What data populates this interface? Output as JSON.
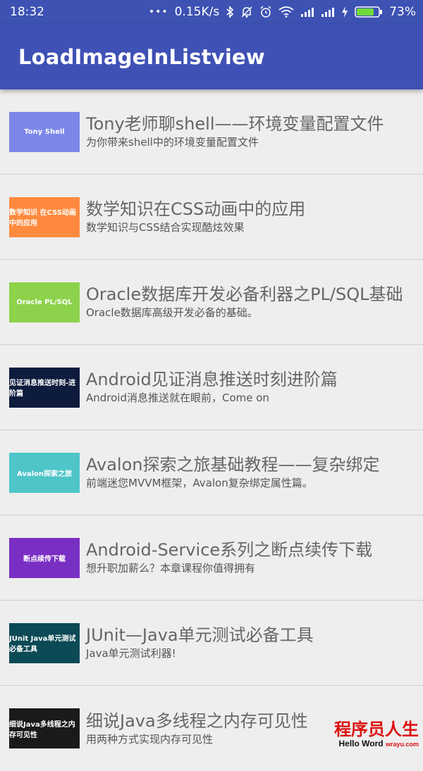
{
  "status_bar": {
    "time": "18:32",
    "dots": "•••",
    "speed": "0.15K/s",
    "battery": "73%"
  },
  "app_bar": {
    "title": "LoadImageInListview"
  },
  "items": [
    {
      "title": "Tony老师聊shell——环境变量配置文件",
      "subtitle": "为你带来shell中的环境变量配置文件",
      "thumb_color": "#7b86e8",
      "thumb_text": "Tony Shell"
    },
    {
      "title": "数学知识在CSS动画中的应用",
      "subtitle": "数学知识与CSS结合实现酷炫效果",
      "thumb_color": "#ff8a3d",
      "thumb_text": "数学知识 在CSS动画中的应用"
    },
    {
      "title": "Oracle数据库开发必备利器之PL/SQL基础",
      "subtitle": "Oracle数据库高级开发必备的基础。",
      "thumb_color": "#8dd24b",
      "thumb_text": "Oracle PL/SQL"
    },
    {
      "title": "Android见证消息推送时刻进阶篇",
      "subtitle": "Android消息推送就在眼前，Come on",
      "thumb_color": "#0d1b3d",
      "thumb_text": "见证消息推送时刻-进阶篇"
    },
    {
      "title": "Avalon探索之旅基础教程——复杂绑定",
      "subtitle": "前端迷您MVVM框架，Avalon复杂绑定属性篇。",
      "thumb_color": "#4ec5c9",
      "thumb_text": "Avalon探索之旅"
    },
    {
      "title": "Android-Service系列之断点续传下载",
      "subtitle": "想升职加薪么？本章课程你值得拥有",
      "thumb_color": "#7a2fc4",
      "thumb_text": "断点续传下载"
    },
    {
      "title": "JUnit—Java单元测试必备工具",
      "subtitle": "Java单元测试利器!",
      "thumb_color": "#0c4a55",
      "thumb_text": "JUnit Java单元测试必备工具"
    },
    {
      "title": "细说Java多线程之内存可见性",
      "subtitle": "用两种方式实现内存可见性",
      "thumb_color": "#1a1a1a",
      "thumb_text": "细说Java多线程之内存可见性"
    }
  ],
  "watermark": {
    "line1": "程序员人生",
    "line2_a": "Hello Word",
    "line2_b": "wrayu.com"
  }
}
